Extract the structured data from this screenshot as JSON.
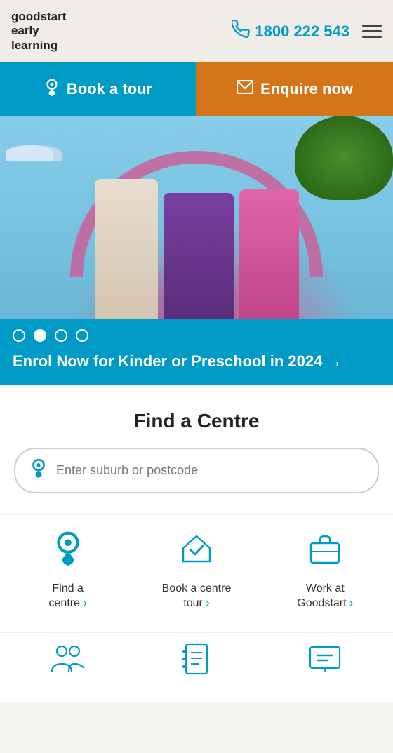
{
  "header": {
    "logo_line1": "goodstart",
    "logo_line2": "early",
    "logo_line3": "learning",
    "phone": "1800 222 543",
    "phone_aria": "Call us"
  },
  "cta": {
    "book_tour": "Book a tour",
    "enquire_now": "Enquire now"
  },
  "hero": {
    "slide_count": 4,
    "active_slide": 1,
    "banner_text": "Enrol Now for Kinder or Preschool in 2024",
    "banner_arrow": "→"
  },
  "find_centre": {
    "title": "Find a Centre",
    "search_placeholder": "Enter suburb or postcode"
  },
  "quick_links": [
    {
      "id": "find-centre",
      "label": "Find a\ncentre ›"
    },
    {
      "id": "book-tour",
      "label": "Book a centre\ntour ›"
    },
    {
      "id": "work-at",
      "label": "Work at\nGoodstart ›"
    }
  ],
  "bottom_icons": [
    {
      "id": "families-icon"
    },
    {
      "id": "contact-icon"
    },
    {
      "id": "resources-icon"
    }
  ],
  "colors": {
    "teal": "#009ac7",
    "orange": "#d4751a",
    "purple": "#8b3a7e",
    "pink": "#c9629a"
  }
}
